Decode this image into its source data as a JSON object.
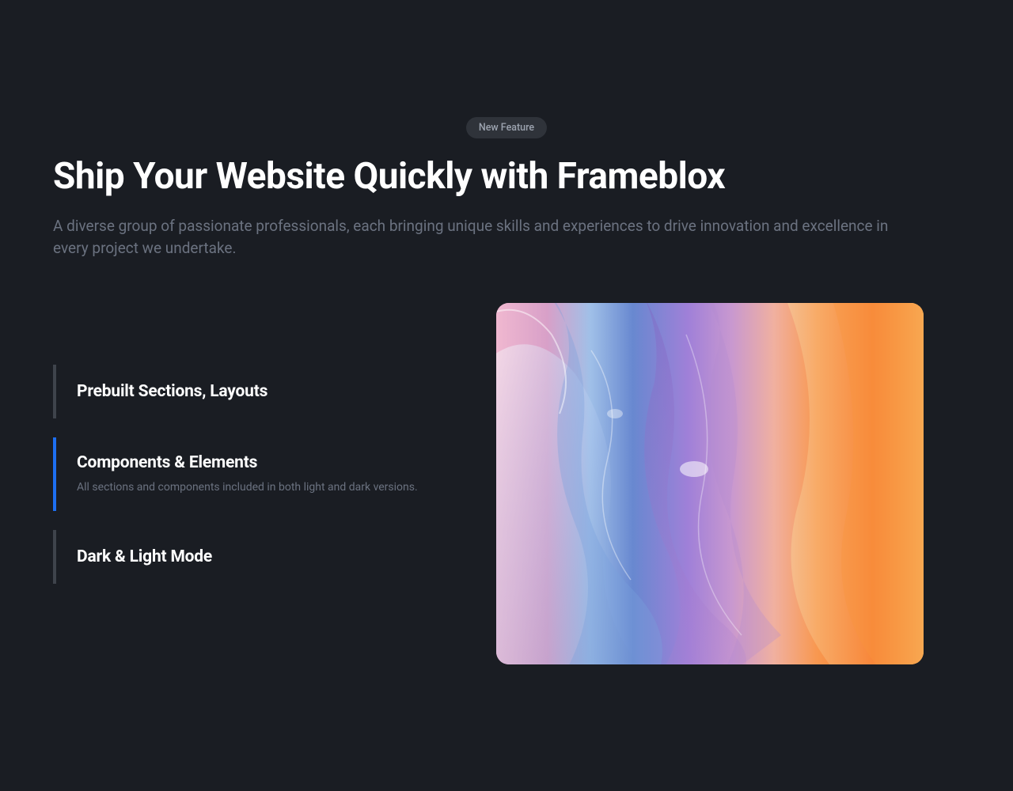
{
  "badge": {
    "label": "New Feature"
  },
  "hero": {
    "headline": "Ship Your Website Quickly with Frameblox",
    "subheadline": "A diverse group of passionate professionals, each bringing unique skills and experiences to drive innovation and excellence in every project we undertake."
  },
  "features": [
    {
      "title": "Prebuilt Sections, Layouts",
      "desc": "",
      "active": false
    },
    {
      "title": "Components & Elements",
      "desc": "All sections and components included in both light and dark versions.",
      "active": true
    },
    {
      "title": "Dark & Light Mode",
      "desc": "",
      "active": false
    }
  ],
  "colors": {
    "accent": "#1d6ff2",
    "bg": "#1a1d23",
    "badge_bg": "#2f333a",
    "muted": "#6b7280"
  }
}
